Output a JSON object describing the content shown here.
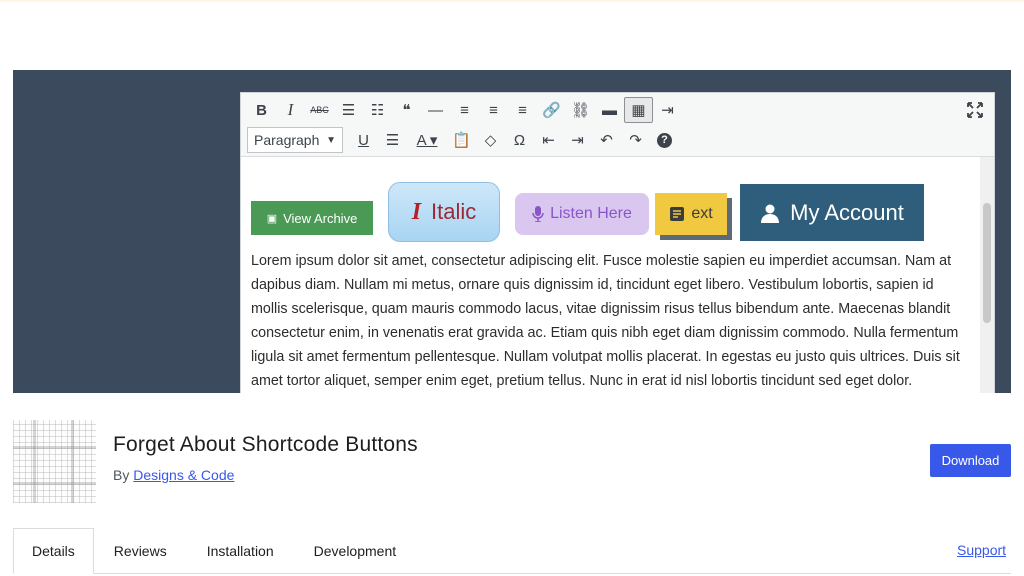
{
  "banner": {
    "editor": {
      "toolbar_row1": [
        {
          "name": "bold-icon",
          "glyph": "B"
        },
        {
          "name": "italic-icon",
          "glyph": "I"
        },
        {
          "name": "strikethrough-icon",
          "glyph": "ABC"
        },
        {
          "name": "bullet-list-icon",
          "glyph": "☰"
        },
        {
          "name": "numbered-list-icon",
          "glyph": "☷"
        },
        {
          "name": "blockquote-icon",
          "glyph": "❝"
        },
        {
          "name": "horizontal-line-icon",
          "glyph": "—"
        },
        {
          "name": "align-left-icon",
          "glyph": "≡"
        },
        {
          "name": "align-center-icon",
          "glyph": "≡"
        },
        {
          "name": "align-right-icon",
          "glyph": "≡"
        },
        {
          "name": "link-icon",
          "glyph": "🔗"
        },
        {
          "name": "unlink-icon",
          "glyph": "⛓"
        },
        {
          "name": "read-more-icon",
          "glyph": "▬"
        },
        {
          "name": "toolbar-toggle-icon",
          "glyph": "▦"
        },
        {
          "name": "shortcode-icon",
          "glyph": "⇥"
        }
      ],
      "format_select": "Paragraph",
      "toolbar_row2": [
        {
          "name": "underline-icon",
          "glyph": "U"
        },
        {
          "name": "justify-icon",
          "glyph": "☰"
        },
        {
          "name": "text-color-icon",
          "glyph": "A"
        },
        {
          "name": "paste-text-icon",
          "glyph": "📋"
        },
        {
          "name": "clear-formatting-icon",
          "glyph": "◇"
        },
        {
          "name": "special-character-icon",
          "glyph": "Ω"
        },
        {
          "name": "outdent-icon",
          "glyph": "⇤"
        },
        {
          "name": "indent-icon",
          "glyph": "⇥"
        },
        {
          "name": "undo-icon",
          "glyph": "↶"
        },
        {
          "name": "redo-icon",
          "glyph": "↷"
        },
        {
          "name": "help-icon",
          "glyph": "?"
        }
      ],
      "sample_buttons": {
        "view_archive": "View Archive",
        "italic": "Italic",
        "listen_here": "Listen Here",
        "text": "ext",
        "my_account": "My Account"
      },
      "lorem": "Lorem ipsum dolor sit amet, consectetur adipiscing elit. Fusce molestie sapien eu imperdiet accumsan. Nam at dapibus diam. Nullam mi metus, ornare quis dignissim id, tincidunt eget libero. Vestibulum lobortis, sapien id mollis scelerisque, quam mauris commodo lacus, vitae dignissim risus tellus bibendum ante. Maecenas blandit consectetur enim, in venenatis erat gravida ac. Etiam quis nibh eget diam dignissim commodo. Nulla fermentum ligula sit amet fermentum pellentesque. Nullam volutpat mollis placerat. In egestas eu justo quis ultrices. Duis sit amet tortor aliquet, semper enim eget, pretium tellus. Nunc in erat id nisl lobortis tincidunt sed eget dolor."
    }
  },
  "plugin": {
    "title": "Forget About Shortcode Buttons",
    "by_prefix": "By",
    "author": "Designs & Code",
    "download_label": "Download"
  },
  "tabs": [
    "Details",
    "Reviews",
    "Installation",
    "Development"
  ],
  "support_label": "Support",
  "colors": {
    "banner_bg": "#3b4a5c",
    "accent": "#3858e9",
    "archive_green": "#4a9a55",
    "account_blue": "#2f5d7c",
    "listen_purple": "#d9c7f0",
    "text_yellow": "#f0c940"
  }
}
